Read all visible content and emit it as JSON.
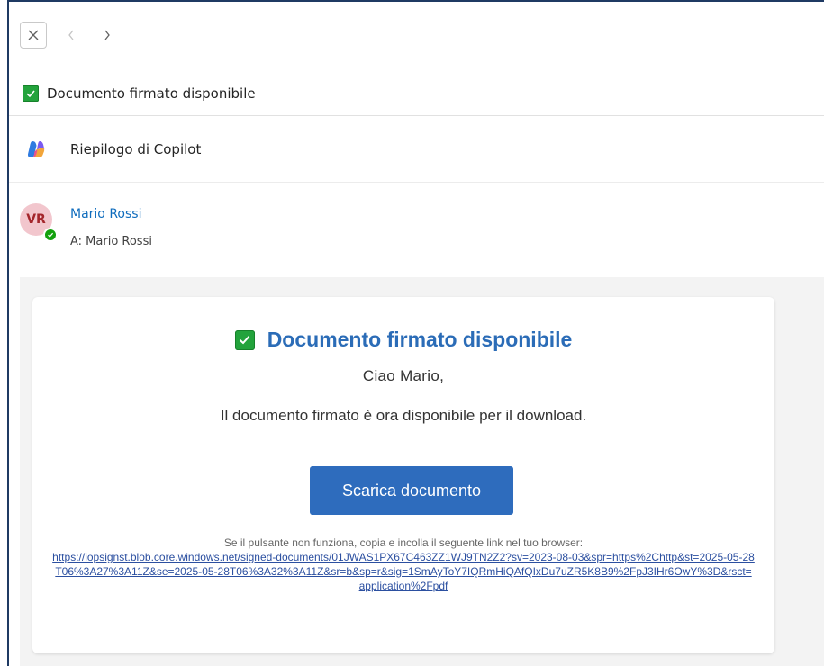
{
  "nav": {
    "close_icon": "close-icon",
    "back_icon": "chevron-left-icon",
    "forward_icon": "chevron-right-icon"
  },
  "subject": {
    "title": "Documento firmato disponibile",
    "icon": "checkbox-checked-icon"
  },
  "copilot": {
    "label": "Riepilogo di Copilot",
    "icon": "copilot-icon"
  },
  "sender": {
    "initials": "VR",
    "name": "Mario Rossi",
    "to": "A: Mario Rossi",
    "presence": "available"
  },
  "email": {
    "title": "Documento firmato disponibile",
    "greeting": "Ciao Mario,",
    "message": "Il documento firmato è ora disponibile per il download.",
    "button_label": "Scarica documento",
    "fallback_note": "Se il pulsante non funziona, copia e incolla il seguente link nel tuo browser:",
    "fallback_link": "https://iopsignst.blob.core.windows.net/signed-documents/01JWAS1PX67C463ZZ1WJ9TN2Z2?sv=2023-08-03&spr=https%2Chttp&st=2025-05-28T06%3A27%3A11Z&se=2025-05-28T06%3A32%3A11Z&sr=b&sp=r&sig=1SmAyToY7IQRmHiQAfQIxDu7uZR5K8B9%2FpJ3IHr6OwY%3D&rsct=application%2Fpdf"
  },
  "colors": {
    "accent": "#2e6cbd",
    "title": "#2b6cb7",
    "link": "#2b4fa0",
    "check": "#23a33c",
    "sender_name": "#0f6cbd",
    "presence": "#13a10e"
  }
}
